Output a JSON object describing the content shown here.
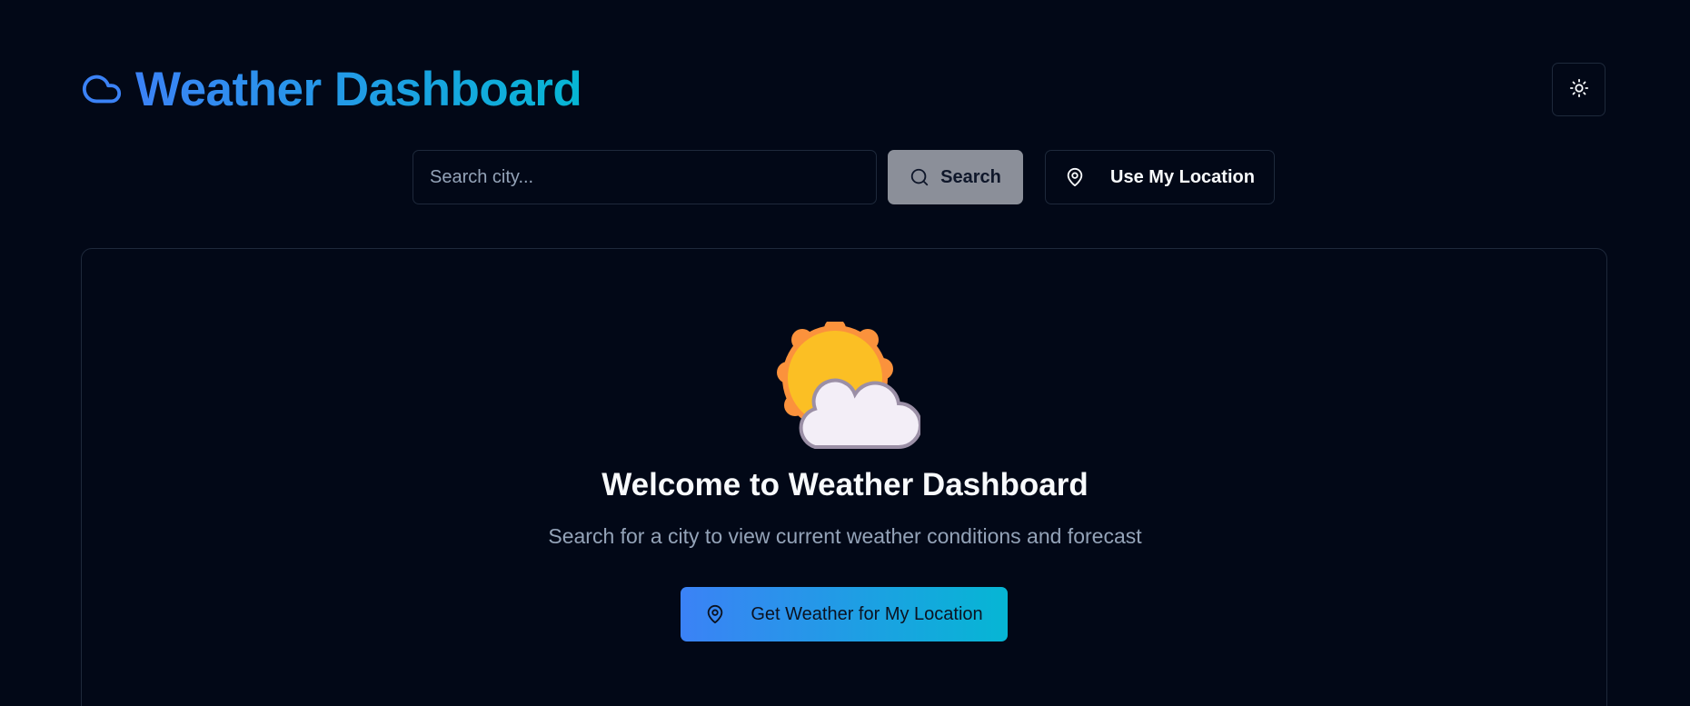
{
  "header": {
    "title": "Weather Dashboard",
    "logo_icon": "cloud-icon",
    "theme_toggle_icon": "theme-toggle-icon"
  },
  "search": {
    "placeholder": "Search city...",
    "value": "",
    "button_label": "Search",
    "button_icon": "search-icon",
    "location_button_label": "Use My Location",
    "location_button_icon": "map-pin-icon"
  },
  "welcome": {
    "illustration": "sun-behind-cloud",
    "title": "Welcome to Weather Dashboard",
    "subtitle": "Search for a city to view current weather conditions and forecast",
    "cta_label": "Get Weather for My Location",
    "cta_icon": "map-pin-icon"
  },
  "colors": {
    "background": "#020817",
    "border": "#1e293b",
    "gradient_start": "#3b82f6",
    "gradient_end": "#06b6d4",
    "muted_text": "#94a3b8",
    "search_button_bg": "#8b8f99"
  }
}
